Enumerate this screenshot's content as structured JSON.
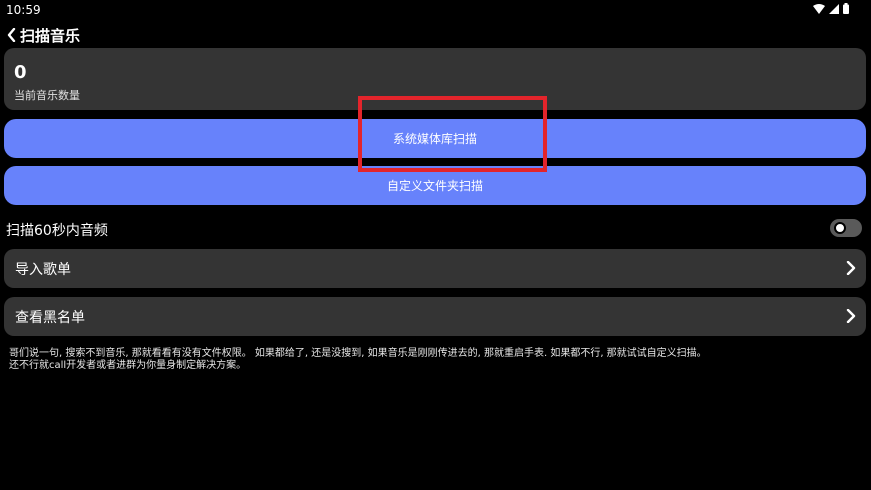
{
  "status": {
    "time": "10:59"
  },
  "header": {
    "title": "扫描音乐"
  },
  "count": {
    "value": "0",
    "label": "当前音乐数量"
  },
  "buttons": {
    "system_scan": "系统媒体库扫描",
    "custom_scan": "自定义文件夹扫描"
  },
  "toggle": {
    "label": "扫描60秒内音频",
    "enabled": false
  },
  "rows": {
    "import_playlist": "导入歌单",
    "view_blacklist": "查看黑名单"
  },
  "note": {
    "line1": "哥们说一句, 搜索不到音乐, 那就看看有没有文件权限。 如果都给了, 还是没搜到, 如果音乐是刚刚传进去的, 那就重启手表. 如果都不行, 那就试试自定义扫描。",
    "line2": "还不行就call开发者或者进群为你量身制定解决方案。"
  },
  "colors": {
    "accent": "#6782fb",
    "card": "#343434",
    "highlight": "#e3242b"
  }
}
